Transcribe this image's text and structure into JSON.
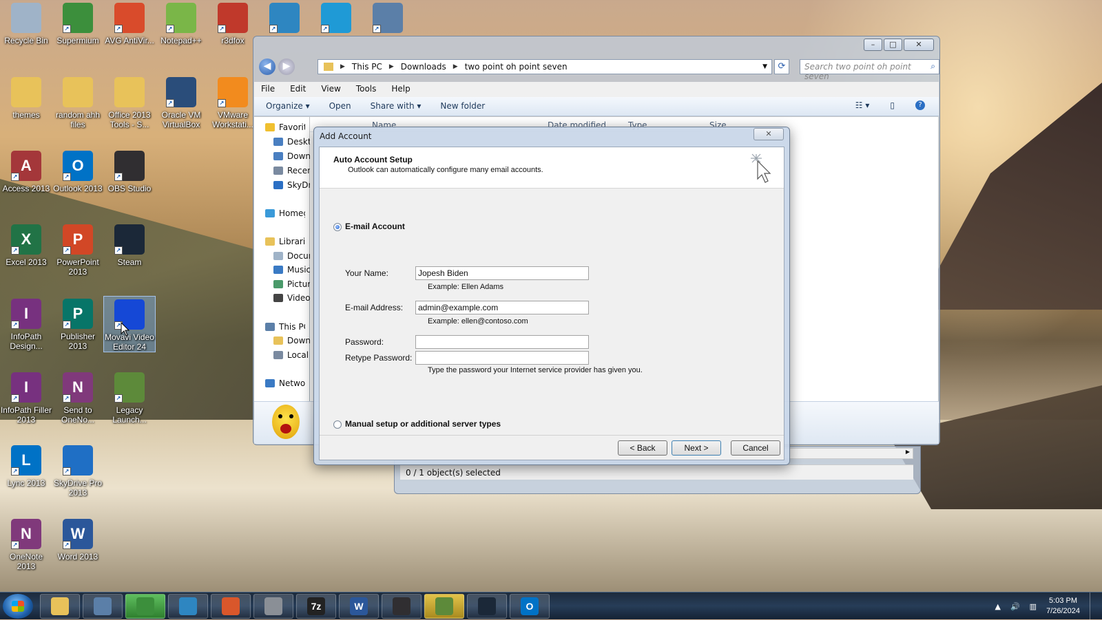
{
  "desktop": {
    "icons": [
      {
        "label": "Recycle Bin",
        "icon": "recycle-bin-icon",
        "color": "#9fb3c8"
      },
      {
        "label": "Supermium",
        "icon": "supermium-icon",
        "color": "#3c8f3c"
      },
      {
        "label": "AVG AntiVir...",
        "icon": "avg-icon",
        "color": "#d94b2b"
      },
      {
        "label": "Notepad++",
        "icon": "notepadpp-icon",
        "color": "#7ab648"
      },
      {
        "label": "r3dfox",
        "icon": "r3dfox-icon",
        "color": "#c0392b"
      },
      {
        "label": "",
        "icon": "globe-icon",
        "color": "#2e86c1"
      },
      {
        "label": "",
        "icon": "arrow-app-icon",
        "color": "#1f9ad6"
      },
      {
        "label": "",
        "icon": "computer-icon",
        "color": "#5b7fa8"
      },
      {
        "label": "themes",
        "icon": "folder-icon",
        "color": "#e8c25a"
      },
      {
        "label": "random ahh files",
        "icon": "folder-icon",
        "color": "#e8c25a"
      },
      {
        "label": "Office 2013 Tools - S...",
        "icon": "folder-icon",
        "color": "#e8c25a"
      },
      {
        "label": "Oracle VM VirtualBox",
        "icon": "virtualbox-icon",
        "color": "#2a4d7a"
      },
      {
        "label": "VMware Workstati...",
        "icon": "vmware-icon",
        "color": "#f28b1e"
      },
      {
        "label": "Access 2013",
        "icon": "access-icon",
        "color": "#a4373a",
        "glyph": "A"
      },
      {
        "label": "Outlook 2013",
        "icon": "outlook-icon",
        "color": "#0072c6",
        "glyph": "O"
      },
      {
        "label": "OBS Studio",
        "icon": "obs-icon",
        "color": "#302e31"
      },
      {
        "label": "Excel 2013",
        "icon": "excel-icon",
        "color": "#217346",
        "glyph": "X"
      },
      {
        "label": "PowerPoint 2013",
        "icon": "powerpoint-icon",
        "color": "#d24726",
        "glyph": "P"
      },
      {
        "label": "Steam",
        "icon": "steam-icon",
        "color": "#1b2838"
      },
      {
        "label": "InfoPath Design...",
        "icon": "infopath-icon",
        "color": "#77317f",
        "glyph": "I"
      },
      {
        "label": "Publisher 2013",
        "icon": "publisher-icon",
        "color": "#077568",
        "glyph": "P"
      },
      {
        "label": "Movavi Video Editor 24",
        "icon": "movavi-icon",
        "color": "#1548d6"
      },
      {
        "label": "InfoPath Filler 2013",
        "icon": "infopath-icon",
        "color": "#77317f",
        "glyph": "I"
      },
      {
        "label": "Send to OneNo...",
        "icon": "onenote-icon",
        "color": "#80397b",
        "glyph": "N"
      },
      {
        "label": "Legacy Launch...",
        "icon": "minecraft-icon",
        "color": "#5d8a3a"
      },
      {
        "label": "Lync 2013",
        "icon": "lync-icon",
        "color": "#0072c6",
        "glyph": "L"
      },
      {
        "label": "SkyDrive Pro 2013",
        "icon": "skydrive-icon",
        "color": "#1f6fc5"
      },
      {
        "label": "OneNote 2013",
        "icon": "onenote-icon",
        "color": "#80397b",
        "glyph": "N"
      },
      {
        "label": "Word 2013",
        "icon": "word-icon",
        "color": "#2b579a",
        "glyph": "W"
      }
    ]
  },
  "explorer": {
    "breadcrumb": [
      "This PC",
      "Downloads",
      "two point oh point seven"
    ],
    "search_placeholder": "Search two point oh point seven",
    "menu": [
      "File",
      "Edit",
      "View",
      "Tools",
      "Help"
    ],
    "commands": [
      "Organize",
      "Open",
      "Share with",
      "New folder"
    ],
    "columns": [
      "Name",
      "Date modified",
      "Type",
      "Size"
    ],
    "nav": [
      {
        "label": "Favorites",
        "icon": "star-icon"
      },
      {
        "label": "Desktop",
        "icon": "desktop-icon"
      },
      {
        "label": "Downloads",
        "icon": "downloads-icon"
      },
      {
        "label": "Recent places",
        "icon": "recent-icon"
      },
      {
        "label": "SkyDrive",
        "icon": "cloud-icon"
      },
      {
        "label": "Homegroup",
        "icon": "homegroup-icon"
      },
      {
        "label": "Libraries",
        "icon": "library-icon"
      },
      {
        "label": "Documents",
        "icon": "documents-icon"
      },
      {
        "label": "Music",
        "icon": "music-icon"
      },
      {
        "label": "Pictures",
        "icon": "pictures-icon"
      },
      {
        "label": "Videos",
        "icon": "videos-icon"
      },
      {
        "label": "This PC",
        "icon": "pc-icon"
      },
      {
        "label": "Downloads",
        "icon": "downloads-icon"
      },
      {
        "label": "Local Disk",
        "icon": "disk-icon"
      },
      {
        "label": "Network",
        "icon": "network-icon"
      }
    ],
    "status": "0 / 1 object(s) selected"
  },
  "dialog": {
    "title": "Add Account",
    "heading": "Auto Account Setup",
    "subheading": "Outlook can automatically configure many email accounts.",
    "option_email": "E-mail Account",
    "option_manual": "Manual setup or additional server types",
    "name_label": "Your Name:",
    "name_value": "Jopesh Biden",
    "name_example": "Example: Ellen Adams",
    "email_label": "E-mail Address:",
    "email_value": "admin@example.com",
    "email_example": "Example: ellen@contoso.com",
    "password_label": "Password:",
    "retype_label": "Retype Password:",
    "password_hint": "Type the password your Internet service provider has given you.",
    "back": "< Back",
    "next": "Next >",
    "cancel": "Cancel"
  },
  "taskbar": {
    "time": "5:03 PM",
    "date": "7/26/2024",
    "apps": [
      {
        "icon": "explorer-icon",
        "color": "#e8c25a"
      },
      {
        "icon": "computer-icon",
        "color": "#5b7fa8"
      },
      {
        "icon": "supermium-icon",
        "color": "#3c8f3c"
      },
      {
        "icon": "globe-icon",
        "color": "#2e86c1"
      },
      {
        "icon": "office-tools-icon",
        "color": "#d9572b"
      },
      {
        "icon": "printer-icon",
        "color": "#8a8f96"
      },
      {
        "icon": "7zip-icon",
        "color": "#222222",
        "glyph": "7z"
      },
      {
        "icon": "word-icon",
        "color": "#2b579a",
        "glyph": "W"
      },
      {
        "icon": "obs-icon",
        "color": "#302e31"
      },
      {
        "icon": "minecraft-icon",
        "color": "#5d8a3a"
      },
      {
        "icon": "steam-icon",
        "color": "#1b2838"
      },
      {
        "icon": "outlook-icon",
        "color": "#0072c6",
        "glyph": "O"
      }
    ]
  }
}
